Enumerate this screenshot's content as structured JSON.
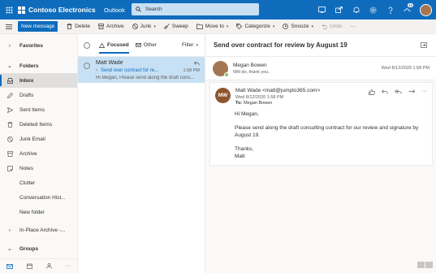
{
  "topbar": {
    "brand": "Contoso Electronics",
    "app": "Outlook",
    "search_placeholder": "Search",
    "badge_count": "11"
  },
  "toolbar": {
    "new_message": "New message",
    "delete": "Delete",
    "archive": "Archive",
    "junk": "Junk",
    "sweep": "Sweep",
    "move_to": "Move to",
    "categorize": "Categorize",
    "snooze": "Snooze",
    "undo": "Undo",
    "more": "···"
  },
  "sidebar": {
    "favorites": "Favorites",
    "folders": "Folders",
    "items": [
      {
        "label": "Inbox"
      },
      {
        "label": "Drafts"
      },
      {
        "label": "Sent Items"
      },
      {
        "label": "Deleted Items"
      },
      {
        "label": "Junk Email"
      },
      {
        "label": "Archive"
      },
      {
        "label": "Notes"
      },
      {
        "label": "Clutter"
      },
      {
        "label": "Conversation Hist..."
      },
      {
        "label": "New folder"
      }
    ],
    "in_place_archive": "In-Place Archive -...",
    "groups": "Groups"
  },
  "list": {
    "focused": "Focused",
    "other": "Other",
    "filter": "Filter",
    "message": {
      "sender": "Matt Wade",
      "subject": "Send over contract for re...",
      "time": "1:58 PM",
      "preview": "Hi Megan, Please send along the draft cons..."
    }
  },
  "reading": {
    "subject": "Send over contract for review by August 19",
    "reply": {
      "name": "Megan Bowen",
      "preview": "Will do, thank you.",
      "date": "Wed 8/12/2020 1:58 PM"
    },
    "original": {
      "initials": "MW",
      "from": "Matt Wade <matt@jumpto365.com>",
      "date": "Wed 8/12/2020 1:58 PM",
      "to_label": "To:",
      "to_name": "Megan Bowen",
      "greeting": "Hi Megan,",
      "body": "Please send along the draft consulting contract for our review and signature by August 19.",
      "closing": "Thanks,",
      "signature": "Matt"
    }
  }
}
